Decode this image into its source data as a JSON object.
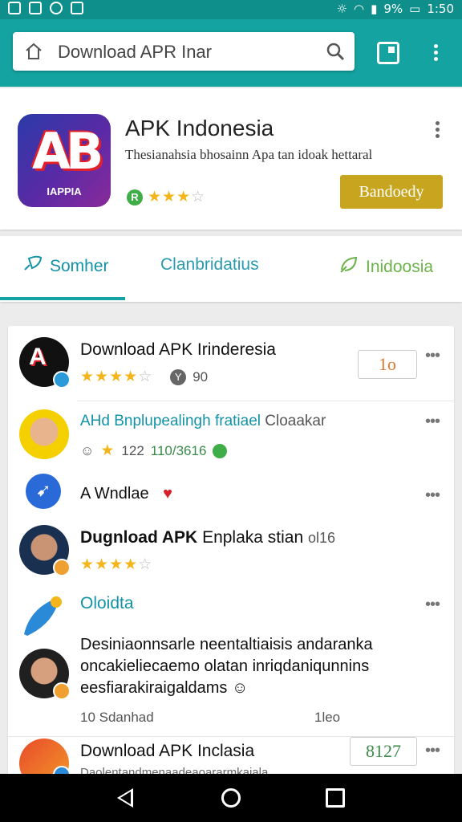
{
  "status_bar": {
    "battery": "9%",
    "time": "1:50"
  },
  "search": {
    "value": "Download APR Inar"
  },
  "app": {
    "title": "APK Indonesia",
    "description": "Thesianahsia bhosainn Apa tan idoak hettaral",
    "logo_caption": "IAPPIA",
    "logo_letters": "AB",
    "rating_badge": "R",
    "rating_stars": 2.5,
    "download_label": "Bandoedy",
    "brand_color": "#14a3a0",
    "button_color": "#c8a51f"
  },
  "tabs": [
    {
      "label": "Somher",
      "icon": "rocket-icon",
      "active": true
    },
    {
      "label": "Clanbridatius",
      "active": false
    },
    {
      "label": "Inidoosia",
      "icon": "leaf-icon",
      "active": false
    }
  ],
  "list": {
    "items": [
      {
        "title": "Download APK Irinderesia",
        "rating_stars": 4,
        "meta": "90",
        "button": "1o"
      },
      {
        "title": "AHd Bnplupealingh fratiael",
        "title_suffix": "Cloaakar",
        "rating_value": "122",
        "meta": "110/3616"
      },
      {
        "title": "A Wndlae"
      },
      {
        "title": "Dugnload APK",
        "title_rest": "Enplaka stian",
        "meta": "ol16",
        "rating_stars": 3.5
      },
      {
        "title": "Oloidta"
      },
      {
        "text_line1": "Desiniaonnsarle neentaltiaisis andaranka",
        "text_line2": "oncakieliecaemo olatan inriqdaniqunnins",
        "text_line3": "eesfiarakiraigaldams",
        "footer_left": "10 Sdanhad",
        "footer_right": "1leo"
      },
      {
        "title": "Download APK",
        "title_rest": "Inclasia",
        "subtitle": "Daolentandmenaadeaoararmkaiala",
        "button": "8127"
      }
    ]
  }
}
